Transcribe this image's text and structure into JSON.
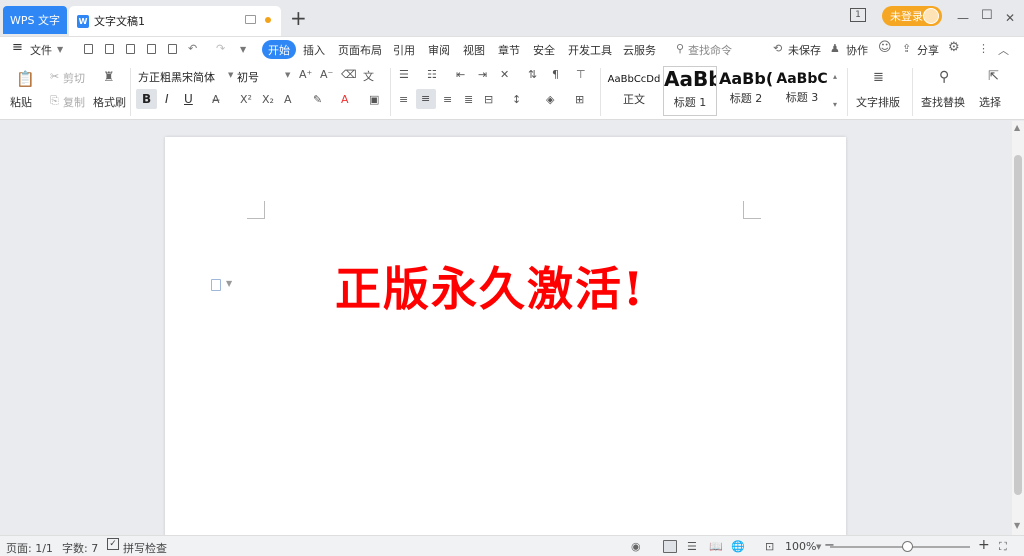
{
  "titlebar": {
    "app_tab": "WPS 文字",
    "doc_tab_name": "文字文稿1",
    "doc_icon_letter": "W",
    "new_tab": "+",
    "login_label": "未登录",
    "page_indicator": "1",
    "minimize": "—",
    "maximize": "☐",
    "close": "✕"
  },
  "menubar": {
    "file_label": "文件",
    "items": [
      "开始",
      "插入",
      "页面布局",
      "引用",
      "审阅",
      "视图",
      "章节",
      "安全",
      "开发工具",
      "云服务"
    ],
    "search_label": "查找命令",
    "unsaved_label": "未保存",
    "collab_label": "协作",
    "share_label": "分享"
  },
  "ribbon": {
    "paste_label": "粘贴",
    "cut_label": "剪切",
    "copy_label": "复制",
    "format_painter_label": "格式刷",
    "font_name": "方正粗黑宋简体",
    "font_size": "初号",
    "bold": "B",
    "italic": "I",
    "underline": "U",
    "styles": [
      {
        "sample": "AaBbCcDd",
        "name": "正文"
      },
      {
        "sample": "AaBb",
        "name": "标题 1"
      },
      {
        "sample": "AaBb(",
        "name": "标题 2"
      },
      {
        "sample": "AaBbC",
        "name": "标题 3"
      }
    ],
    "text_layout_label": "文字排版",
    "find_replace_label": "查找替换",
    "select_label": "选择"
  },
  "document": {
    "headline": "正版永久激活!",
    "headline_color": "#ff0000"
  },
  "statusbar": {
    "page_label": "页面: 1/1",
    "word_count_label": "字数: 7",
    "spellcheck_label": "拼写检查",
    "zoom_label": "100%",
    "zoom_minus": "−",
    "zoom_plus": "+"
  },
  "colors": {
    "accent": "#2f86f5",
    "login": "#f5a623"
  }
}
